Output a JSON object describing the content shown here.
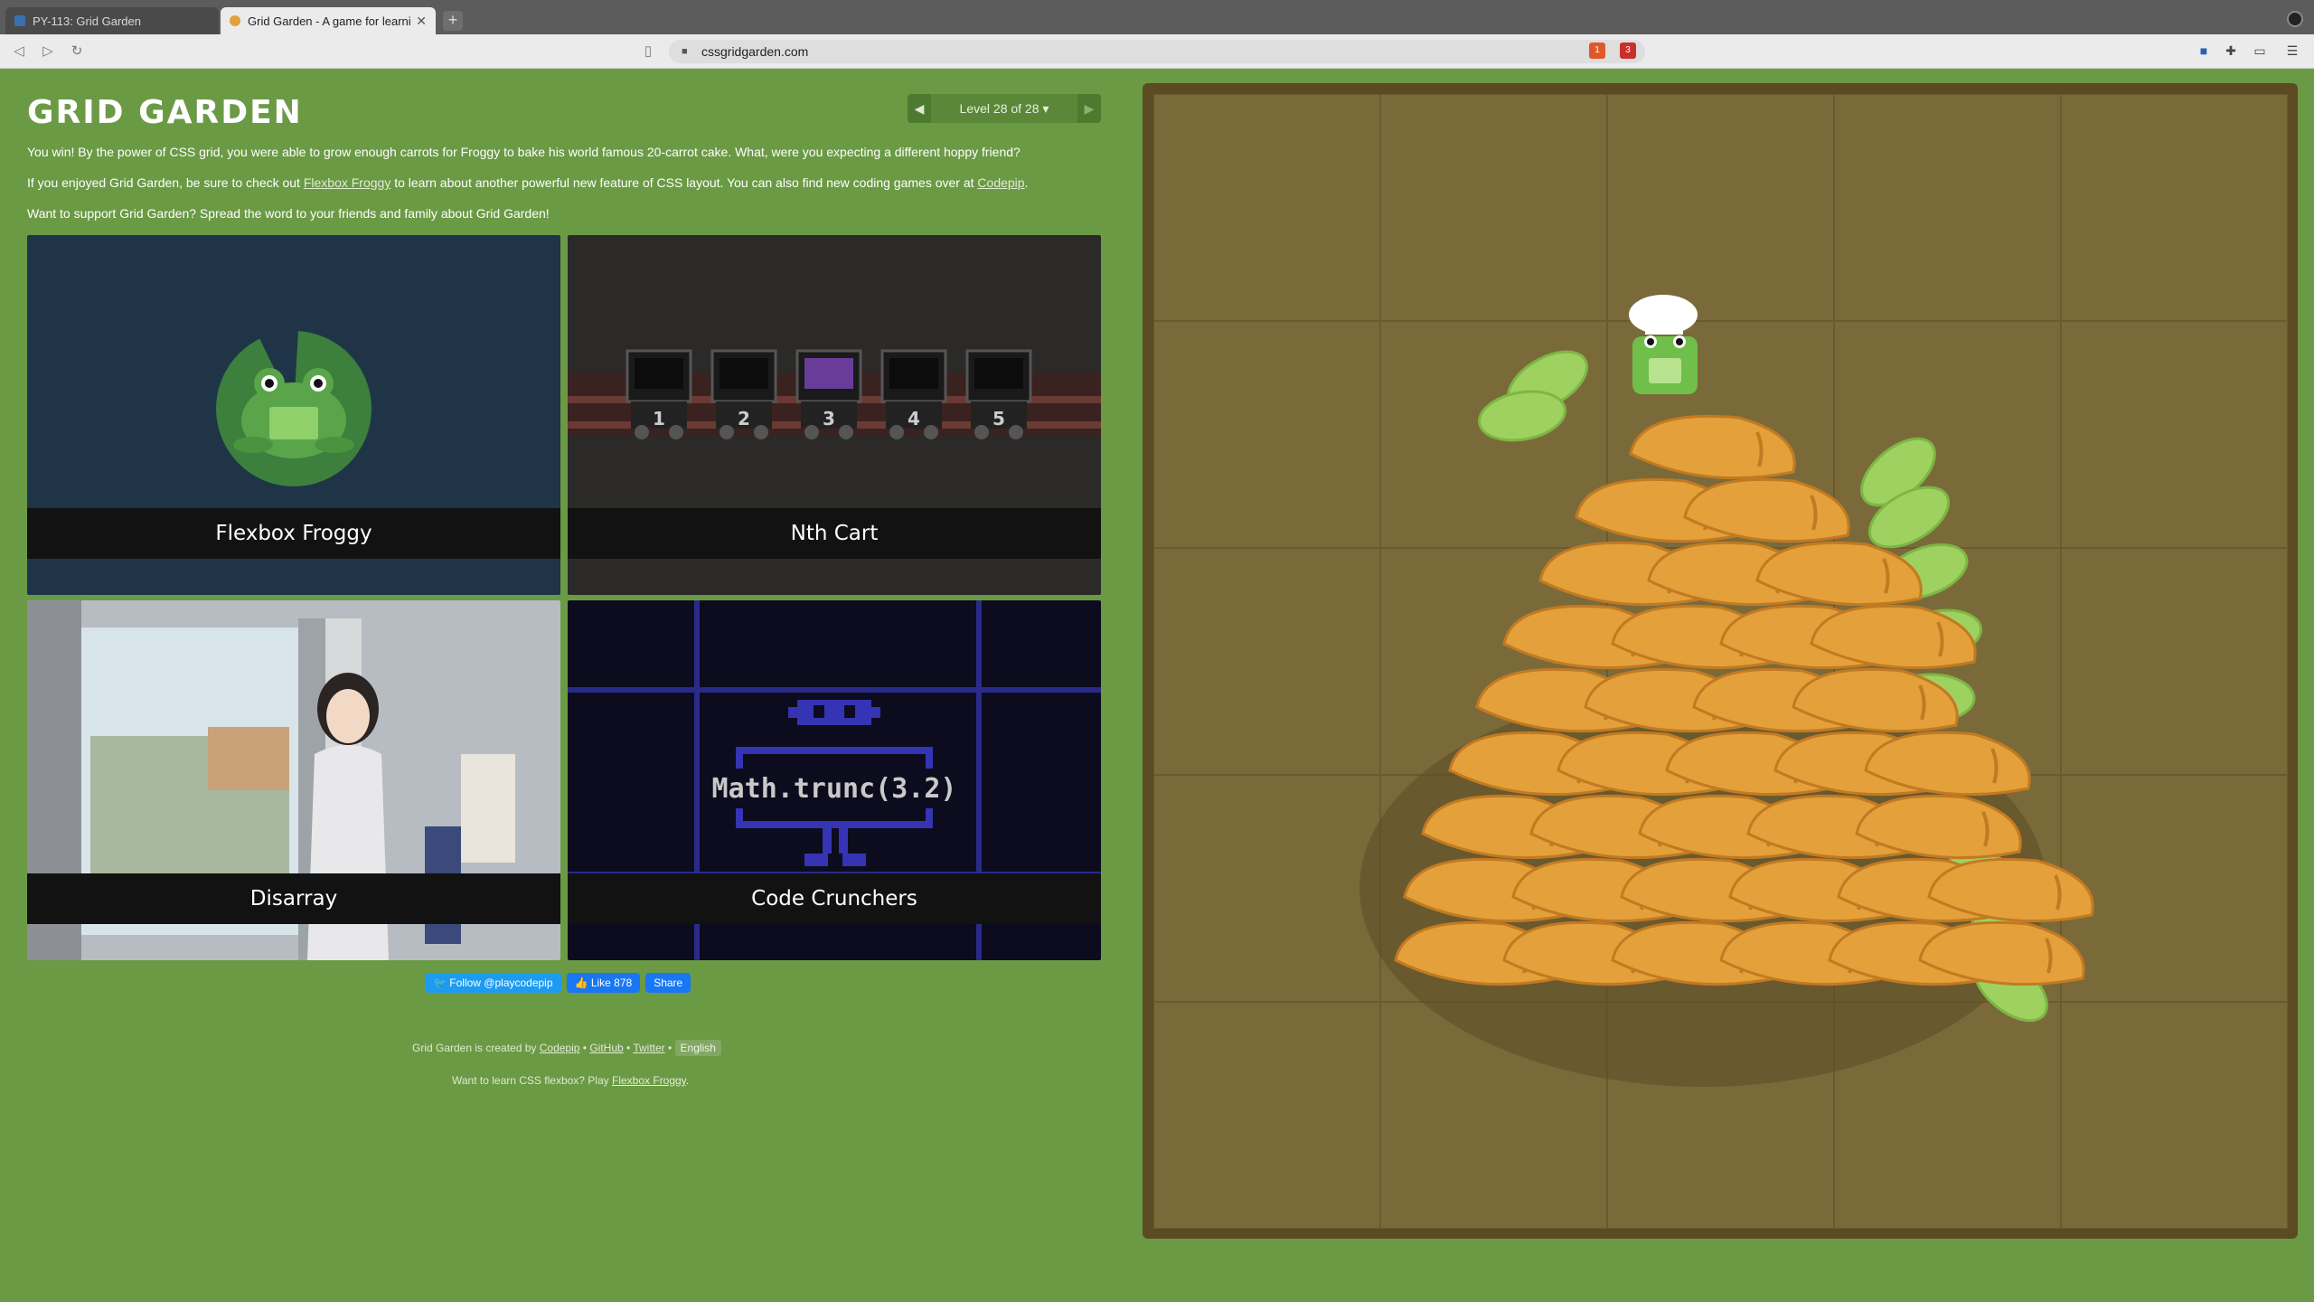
{
  "browser": {
    "tabs": [
      {
        "title": "PY-113: Grid Garden",
        "active": false
      },
      {
        "title": "Grid Garden - A game for learni",
        "active": true
      }
    ],
    "url": "cssgridgarden.com",
    "extension_badges": {
      "brave": "1",
      "alert": "3"
    }
  },
  "page": {
    "title": "GRID GARDEN",
    "level": {
      "label": "Level 28 of 28",
      "prev_icon": "triangle-left-icon",
      "next_icon": "triangle-right-icon"
    },
    "paragraphs": {
      "win": "You win! By the power of CSS grid, you were able to grow enough carrots for Froggy to bake his world famous 20-carrot cake. What, were you expecting a different hoppy friend?",
      "enjoy_pre": "If you enjoyed Grid Garden, be sure to check out ",
      "enjoy_link1": "Flexbox Froggy",
      "enjoy_mid": " to learn about another powerful new feature of CSS layout. You can also find new coding games over at ",
      "enjoy_link2": "Codepip",
      "enjoy_post": ".",
      "support": "Want to support Grid Garden? Spread the word to your friends and family about Grid Garden!"
    },
    "games": [
      {
        "name": "Flexbox Froggy"
      },
      {
        "name": "Nth Cart",
        "carts": [
          "1",
          "2",
          "3",
          "4",
          "5"
        ]
      },
      {
        "name": "Disarray"
      },
      {
        "name": "Code Crunchers",
        "code": "Math.trunc(3.2)"
      }
    ],
    "social": {
      "follow": "Follow @playcodepip",
      "like": "Like 878",
      "share": "Share"
    },
    "footer": {
      "created_by": "Grid Garden is created by ",
      "codepip": "Codepip",
      "sep": " • ",
      "github": "GitHub",
      "twitter": "Twitter",
      "language": "English",
      "flex_pre": "Want to learn CSS flexbox? Play ",
      "flex_link": "Flexbox Froggy",
      "flex_post": "."
    }
  },
  "colors": {
    "page_bg": "#6b9a45",
    "soil": "#7a6a3a",
    "carrot": "#e4a03a",
    "leaf": "#9fd160",
    "frog": "#6fbf4a"
  }
}
